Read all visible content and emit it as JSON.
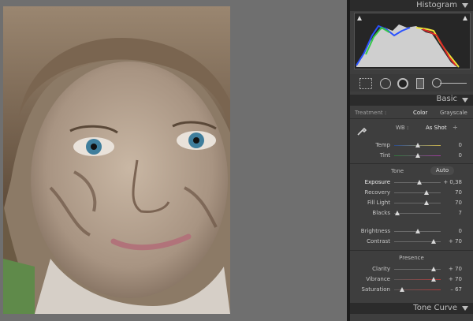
{
  "panel": {
    "histogram_title": "Histogram",
    "basic_title": "Basic",
    "tone_curve_title": "Tone Curve",
    "treatment_label": "Treatment :",
    "treatment_color": "Color",
    "treatment_grayscale": "Grayscale",
    "wb_label": "WB :",
    "wb_value": "As Shot",
    "wb_chevron": "÷",
    "tone_label": "Tone",
    "auto_label": "Auto",
    "presence_label": "Presence"
  },
  "sliders": {
    "temp": {
      "label": "Temp",
      "value": "0",
      "level": 0.5
    },
    "tint": {
      "label": "Tint",
      "value": "0",
      "level": 0.5
    },
    "exposure": {
      "label": "Exposure",
      "value": "+ 0,38",
      "level": 0.55
    },
    "recovery": {
      "label": "Recovery",
      "value": "70",
      "level": 0.7
    },
    "fill_light": {
      "label": "Fill Light",
      "value": "70",
      "level": 0.7
    },
    "blacks": {
      "label": "Blacks",
      "value": "7",
      "level": 0.07
    },
    "brightness": {
      "label": "Brightness",
      "value": "0",
      "level": 0.5
    },
    "contrast": {
      "label": "Contrast",
      "value": "+ 70",
      "level": 0.85
    },
    "clarity": {
      "label": "Clarity",
      "value": "+ 70",
      "level": 0.85
    },
    "vibrance": {
      "label": "Vibrance",
      "value": "+ 70",
      "level": 0.85
    },
    "saturation": {
      "label": "Saturation",
      "value": "– 67",
      "level": 0.17
    }
  },
  "colors": {
    "panel": "#3e3e3e",
    "header": "#2b2b2b",
    "viewer": "#6f6f6f"
  }
}
